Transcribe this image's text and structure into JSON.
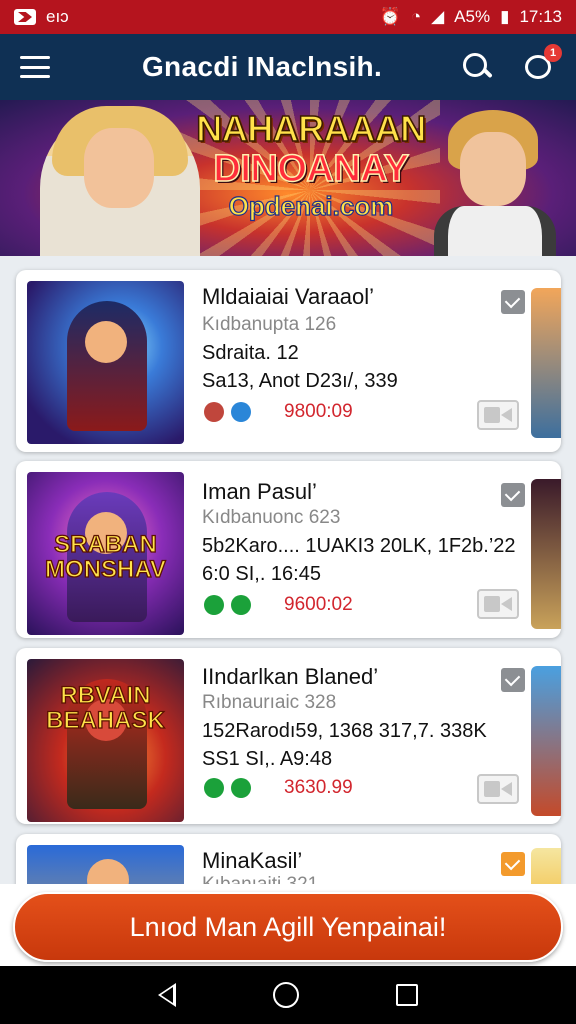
{
  "status_bar": {
    "carrier": "ᗯ",
    "left_text": "eıɔ",
    "battery": "A5%",
    "time": "17:13"
  },
  "header": {
    "title": "Gnacdi INaclnsih.",
    "notification_count": "1"
  },
  "banner": {
    "line1": "NAHARAAAN",
    "line2": "DINOANAY",
    "line3": "Opdenai.com"
  },
  "cards": [
    {
      "title": "Mldaiaiai Varaaol’",
      "subtitle": "Kıdbanupta 126",
      "meta1": "Sdraita. 12",
      "meta2": "Sa13, Anot D23ı/, 339",
      "price": "9800:09",
      "thumb_text": "",
      "dot_colors": [
        "#c0463c",
        "#2a86d8"
      ],
      "check_color": "#8c8f93"
    },
    {
      "title": "Iman Pasul’",
      "subtitle": "Kıdbanuonc 623",
      "meta1": "5b2Karo.... 1UAKI3 20LK, 1F2b.’22",
      "meta2": "6:0 SI,. 16:45",
      "price": "9600:02",
      "thumb_text": "SRABAN MONSHAV",
      "dot_colors": [
        "#1ba13a",
        "#1ba13a"
      ],
      "check_color": "#8c8f93"
    },
    {
      "title": "IIndarlkan Blaned’",
      "subtitle": "Rıbnaurıaic 328",
      "meta1": "152Rarodı59, 1368 317,7. 338K",
      "meta2": "SS1 SI,. A9:48",
      "price": "3630.99",
      "thumb_text": "RBVAIN BEAHASK",
      "dot_colors": [
        "#1ba13a",
        "#1ba13a"
      ],
      "check_color": "#8c8f93"
    },
    {
      "title": "MinaKasil’",
      "subtitle": "Kıbanıaiti 321",
      "meta1": "",
      "meta2": "",
      "price": "",
      "thumb_text": "",
      "dot_colors": [],
      "check_color": "#f39a2c"
    }
  ],
  "cta": {
    "label": "Lnıod Man Agill Yenpainai!"
  },
  "colors": {
    "status_bar": "#b5141e",
    "app_bar": "#0f3054",
    "price": "#d2262e",
    "cta": "#d8440f"
  },
  "icons": {
    "menu": "hamburger-menu-icon",
    "search": "search-icon",
    "chat": "chat-icon",
    "check": "check-icon",
    "video": "video-icon"
  }
}
